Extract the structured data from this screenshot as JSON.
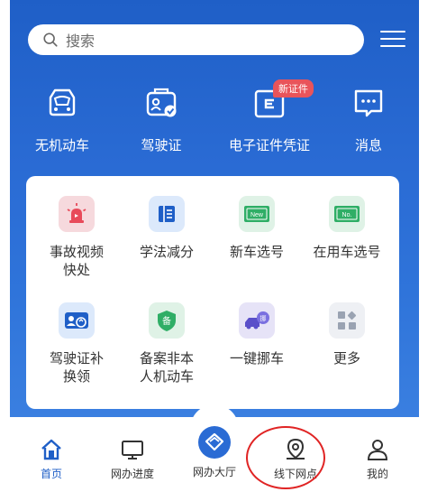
{
  "search": {
    "placeholder": "搜索",
    "icon": "search-icon"
  },
  "menu": {
    "icon": "hamburger-menu-icon"
  },
  "quick": [
    {
      "label": "无机动车",
      "icon": "car-outline-icon"
    },
    {
      "label": "驾驶证",
      "icon": "license-card-icon"
    },
    {
      "label": "电子证件凭证",
      "icon": "e-certificate-icon",
      "badge": "新证件"
    },
    {
      "label": "消息",
      "icon": "message-icon"
    }
  ],
  "services": [
    {
      "label1": "事故视频",
      "label2": "快处",
      "icon": "alarm-siren-icon",
      "color": "#f6d9dd"
    },
    {
      "label1": "学法减分",
      "label2": "",
      "icon": "book-icon",
      "color": "#dce9fb"
    },
    {
      "label1": "新车选号",
      "label2": "",
      "icon": "new-plate-icon",
      "color": "#dff2e6"
    },
    {
      "label1": "在用车选号",
      "label2": "",
      "icon": "plate-no-icon",
      "color": "#dff2e6"
    },
    {
      "label1": "驾驶证补",
      "label2": "换领",
      "icon": "license-renew-icon",
      "color": "#dce9fb"
    },
    {
      "label1": "备案非本",
      "label2": "人机动车",
      "icon": "shield-record-icon",
      "color": "#dff2e6"
    },
    {
      "label1": "一键挪车",
      "label2": "",
      "icon": "move-car-icon",
      "color": "#e6e3f7"
    },
    {
      "label1": "更多",
      "label2": "",
      "icon": "more-grid-icon",
      "color": "#eef0f4"
    }
  ],
  "nav": [
    {
      "label": "首页",
      "icon": "home-icon"
    },
    {
      "label": "网办进度",
      "icon": "monitor-icon"
    },
    {
      "label": "网办大厅",
      "icon": "hall-diamond-icon"
    },
    {
      "label": "线下网点",
      "icon": "location-pin-icon"
    },
    {
      "label": "我的",
      "icon": "user-icon"
    }
  ],
  "colors": {
    "primary": "#1f5fc7",
    "badge": "#e9545a",
    "annotation": "#e02424"
  }
}
